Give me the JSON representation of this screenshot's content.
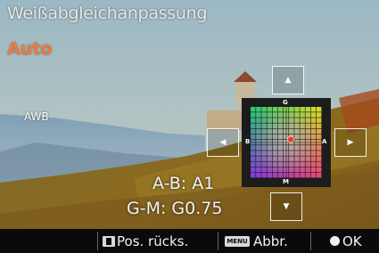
{
  "screen": {
    "title": "Weißabgleichanpassung",
    "mode": "Auto",
    "wb_label": "AWB"
  },
  "grid": {
    "label_g": "G",
    "label_m": "M",
    "label_b": "B",
    "label_a": "A",
    "cursor_color": "#e8402f"
  },
  "readout": {
    "ab": "A-B: A1",
    "gm": "G-M: G0.75"
  },
  "bottom_bar": {
    "reset_label": "Pos. rücks.",
    "menu_key": "MENU",
    "cancel_label": "Abbr.",
    "ok_label": "OK"
  },
  "colors": {
    "mode_text": "#f07a3a",
    "title_text": "#e9e9e9"
  }
}
